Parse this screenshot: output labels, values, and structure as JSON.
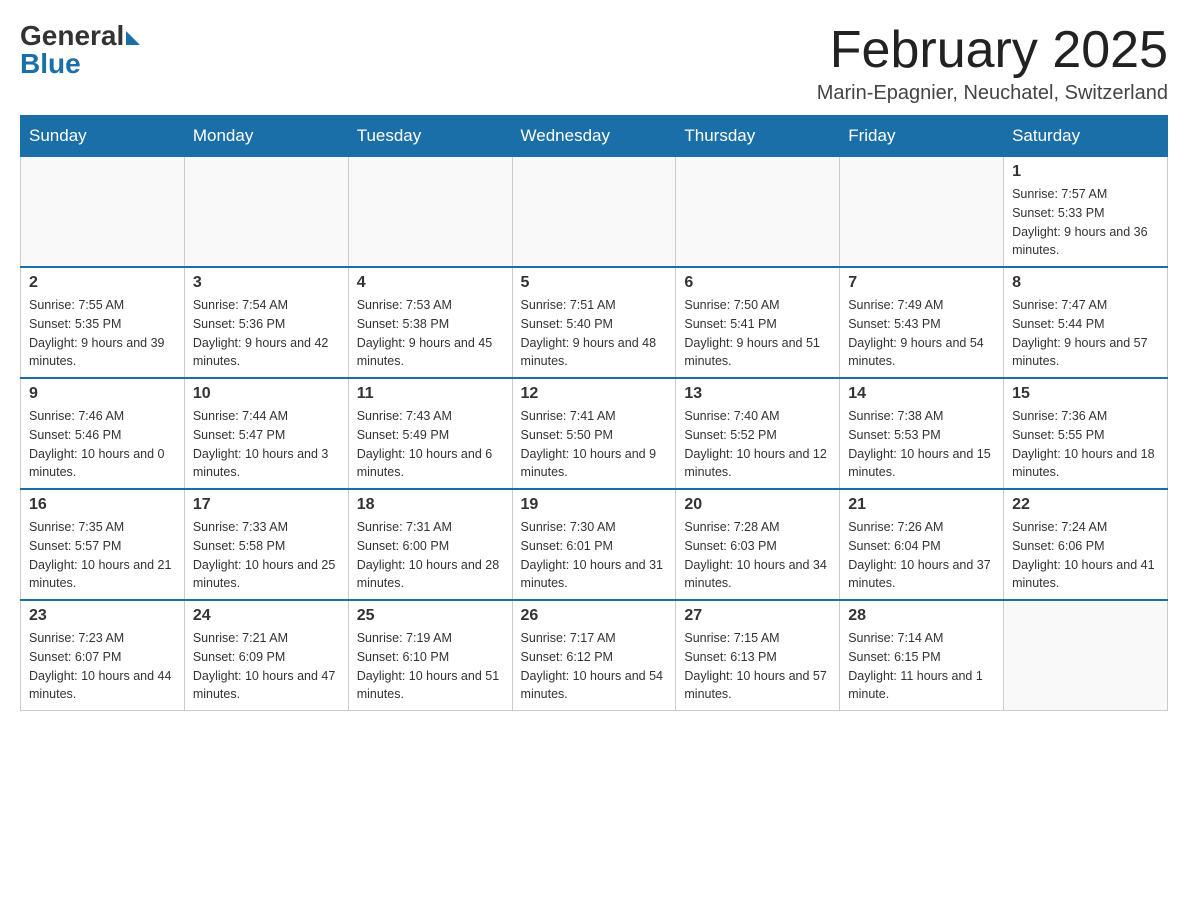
{
  "header": {
    "logo_general": "General",
    "logo_blue": "Blue",
    "month_title": "February 2025",
    "location": "Marin-Epagnier, Neuchatel, Switzerland"
  },
  "weekdays": [
    "Sunday",
    "Monday",
    "Tuesday",
    "Wednesday",
    "Thursday",
    "Friday",
    "Saturday"
  ],
  "weeks": [
    [
      {
        "day": "",
        "info": ""
      },
      {
        "day": "",
        "info": ""
      },
      {
        "day": "",
        "info": ""
      },
      {
        "day": "",
        "info": ""
      },
      {
        "day": "",
        "info": ""
      },
      {
        "day": "",
        "info": ""
      },
      {
        "day": "1",
        "info": "Sunrise: 7:57 AM\nSunset: 5:33 PM\nDaylight: 9 hours and 36 minutes."
      }
    ],
    [
      {
        "day": "2",
        "info": "Sunrise: 7:55 AM\nSunset: 5:35 PM\nDaylight: 9 hours and 39 minutes."
      },
      {
        "day": "3",
        "info": "Sunrise: 7:54 AM\nSunset: 5:36 PM\nDaylight: 9 hours and 42 minutes."
      },
      {
        "day": "4",
        "info": "Sunrise: 7:53 AM\nSunset: 5:38 PM\nDaylight: 9 hours and 45 minutes."
      },
      {
        "day": "5",
        "info": "Sunrise: 7:51 AM\nSunset: 5:40 PM\nDaylight: 9 hours and 48 minutes."
      },
      {
        "day": "6",
        "info": "Sunrise: 7:50 AM\nSunset: 5:41 PM\nDaylight: 9 hours and 51 minutes."
      },
      {
        "day": "7",
        "info": "Sunrise: 7:49 AM\nSunset: 5:43 PM\nDaylight: 9 hours and 54 minutes."
      },
      {
        "day": "8",
        "info": "Sunrise: 7:47 AM\nSunset: 5:44 PM\nDaylight: 9 hours and 57 minutes."
      }
    ],
    [
      {
        "day": "9",
        "info": "Sunrise: 7:46 AM\nSunset: 5:46 PM\nDaylight: 10 hours and 0 minutes."
      },
      {
        "day": "10",
        "info": "Sunrise: 7:44 AM\nSunset: 5:47 PM\nDaylight: 10 hours and 3 minutes."
      },
      {
        "day": "11",
        "info": "Sunrise: 7:43 AM\nSunset: 5:49 PM\nDaylight: 10 hours and 6 minutes."
      },
      {
        "day": "12",
        "info": "Sunrise: 7:41 AM\nSunset: 5:50 PM\nDaylight: 10 hours and 9 minutes."
      },
      {
        "day": "13",
        "info": "Sunrise: 7:40 AM\nSunset: 5:52 PM\nDaylight: 10 hours and 12 minutes."
      },
      {
        "day": "14",
        "info": "Sunrise: 7:38 AM\nSunset: 5:53 PM\nDaylight: 10 hours and 15 minutes."
      },
      {
        "day": "15",
        "info": "Sunrise: 7:36 AM\nSunset: 5:55 PM\nDaylight: 10 hours and 18 minutes."
      }
    ],
    [
      {
        "day": "16",
        "info": "Sunrise: 7:35 AM\nSunset: 5:57 PM\nDaylight: 10 hours and 21 minutes."
      },
      {
        "day": "17",
        "info": "Sunrise: 7:33 AM\nSunset: 5:58 PM\nDaylight: 10 hours and 25 minutes."
      },
      {
        "day": "18",
        "info": "Sunrise: 7:31 AM\nSunset: 6:00 PM\nDaylight: 10 hours and 28 minutes."
      },
      {
        "day": "19",
        "info": "Sunrise: 7:30 AM\nSunset: 6:01 PM\nDaylight: 10 hours and 31 minutes."
      },
      {
        "day": "20",
        "info": "Sunrise: 7:28 AM\nSunset: 6:03 PM\nDaylight: 10 hours and 34 minutes."
      },
      {
        "day": "21",
        "info": "Sunrise: 7:26 AM\nSunset: 6:04 PM\nDaylight: 10 hours and 37 minutes."
      },
      {
        "day": "22",
        "info": "Sunrise: 7:24 AM\nSunset: 6:06 PM\nDaylight: 10 hours and 41 minutes."
      }
    ],
    [
      {
        "day": "23",
        "info": "Sunrise: 7:23 AM\nSunset: 6:07 PM\nDaylight: 10 hours and 44 minutes."
      },
      {
        "day": "24",
        "info": "Sunrise: 7:21 AM\nSunset: 6:09 PM\nDaylight: 10 hours and 47 minutes."
      },
      {
        "day": "25",
        "info": "Sunrise: 7:19 AM\nSunset: 6:10 PM\nDaylight: 10 hours and 51 minutes."
      },
      {
        "day": "26",
        "info": "Sunrise: 7:17 AM\nSunset: 6:12 PM\nDaylight: 10 hours and 54 minutes."
      },
      {
        "day": "27",
        "info": "Sunrise: 7:15 AM\nSunset: 6:13 PM\nDaylight: 10 hours and 57 minutes."
      },
      {
        "day": "28",
        "info": "Sunrise: 7:14 AM\nSunset: 6:15 PM\nDaylight: 11 hours and 1 minute."
      },
      {
        "day": "",
        "info": ""
      }
    ]
  ]
}
